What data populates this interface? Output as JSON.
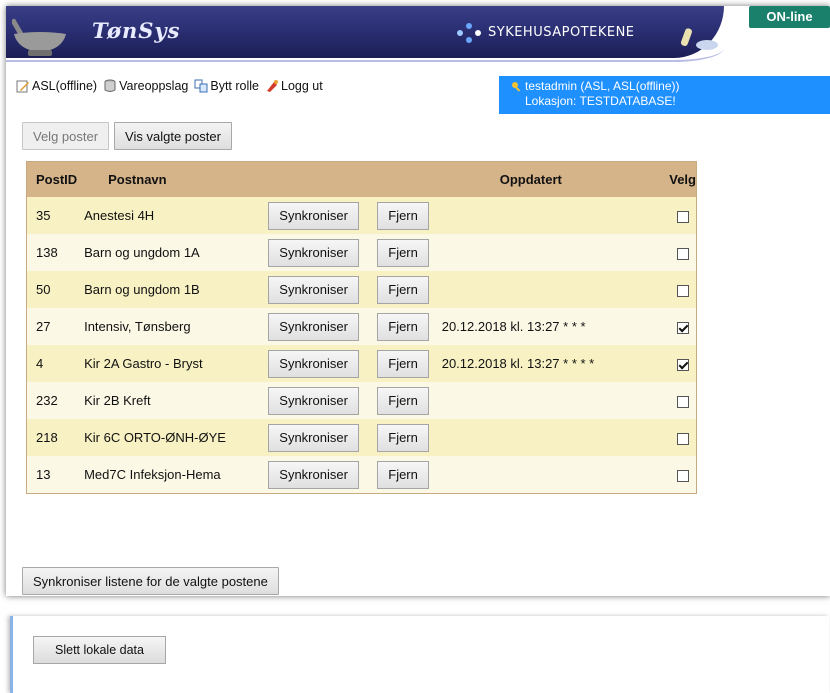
{
  "header": {
    "app_logo": "TønSys",
    "brand": "SYKEHUSAPOTEKENE",
    "status": "ON-line"
  },
  "menu": [
    {
      "label": "ASL(offline)",
      "icon": "edit-note-icon"
    },
    {
      "label": "Vareoppslag",
      "icon": "database-icon"
    },
    {
      "label": "Bytt rolle",
      "icon": "switch-role-icon"
    },
    {
      "label": "Logg ut",
      "icon": "logout-icon"
    }
  ],
  "user": {
    "line1": "testadmin (ASL, ASL(offline))",
    "line2": "Lokasjon: TESTDATABASE!"
  },
  "buttons": {
    "velg_poster": "Velg poster",
    "vis_valgte": "Vis valgte poster",
    "sync_all": "Synkroniser listene for de valgte postene",
    "slett": "Slett lokale data"
  },
  "table": {
    "headers": {
      "id": "PostID",
      "name": "Postnavn",
      "updated": "Oppdatert",
      "select": "Velg"
    },
    "sync_label": "Synkroniser",
    "remove_label": "Fjern",
    "rows": [
      {
        "id": "35",
        "name": "Anestesi 4H",
        "updated": "",
        "checked": false
      },
      {
        "id": "138",
        "name": "Barn og ungdom 1A",
        "updated": "",
        "checked": false
      },
      {
        "id": "50",
        "name": "Barn og ungdom 1B",
        "updated": "",
        "checked": false
      },
      {
        "id": "27",
        "name": "Intensiv, Tønsberg",
        "updated": "20.12.2018 kl. 13:27 * * *",
        "checked": true
      },
      {
        "id": "4",
        "name": "Kir 2A Gastro - Bryst",
        "updated": "20.12.2018 kl. 13:27 * * * *",
        "checked": true
      },
      {
        "id": "232",
        "name": "Kir 2B Kreft",
        "updated": "",
        "checked": false
      },
      {
        "id": "218",
        "name": "Kir 6C ORTO-ØNH-ØYE",
        "updated": "",
        "checked": false
      },
      {
        "id": "13",
        "name": "Med7C Infeksjon-Hema",
        "updated": "",
        "checked": false
      }
    ]
  },
  "colors": {
    "banner": "#2b2f74",
    "online": "#1a7f6b",
    "userbox": "#1e90ff",
    "table_header": "#d6b48a",
    "row_odd": "#f7f1c3",
    "row_even": "#fbf8e6"
  }
}
